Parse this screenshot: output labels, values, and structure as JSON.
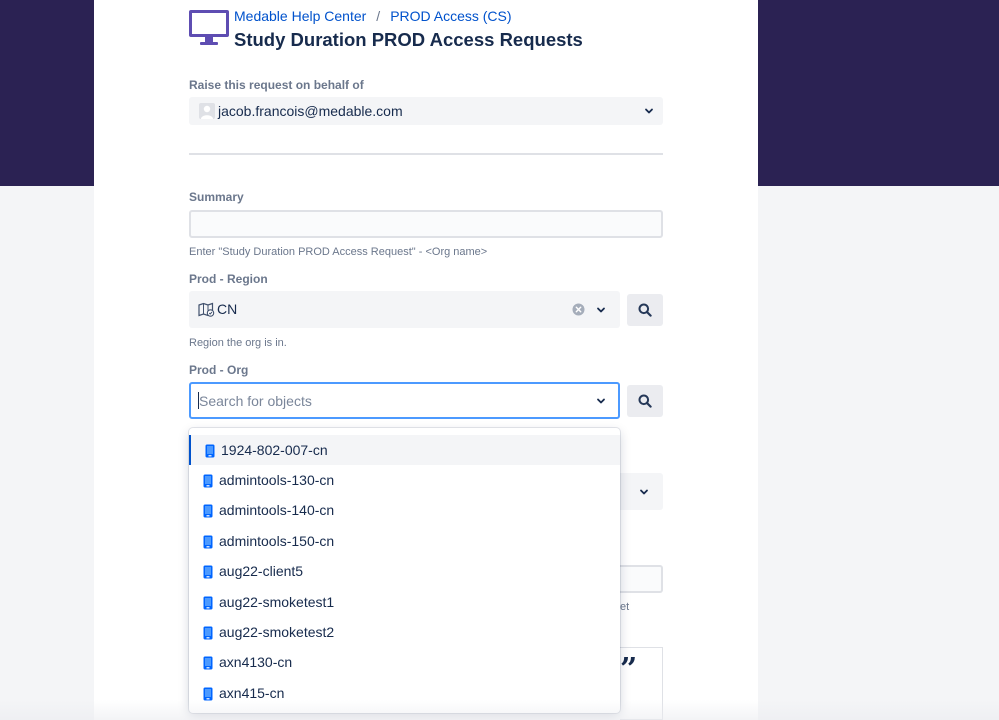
{
  "breadcrumb": {
    "root": "Medable Help Center",
    "separator": "/",
    "project": "PROD Access (CS)"
  },
  "page": {
    "title": "Study Duration PROD Access Requests"
  },
  "behalf": {
    "label": "Raise this request on behalf of",
    "value": "jacob.francois@medable.com"
  },
  "summary": {
    "label": "Summary",
    "value": "",
    "help": "Enter \"Study Duration PROD Access Request\" - <Org name>"
  },
  "region": {
    "label": "Prod - Region",
    "value": "CN",
    "help": "Region the org is in."
  },
  "org": {
    "label": "Prod - Org",
    "placeholder": "Search for objects",
    "options": [
      "1924-802-007-cn",
      "admintools-130-cn",
      "admintools-140-cn",
      "admintools-150-cn",
      "aug22-client5",
      "aug22-smoketest1",
      "aug22-smoketest2",
      "axn4130-cn",
      "axn415-cn"
    ]
  },
  "partial": {
    "help_tail": "et",
    "quote": "”"
  },
  "colors": {
    "hero": "#2b2253",
    "link": "#0052cc",
    "focus": "#4c9aff"
  },
  "icons": {
    "portal": "monitor-icon",
    "region": "map-icon",
    "option": "object-icon"
  }
}
